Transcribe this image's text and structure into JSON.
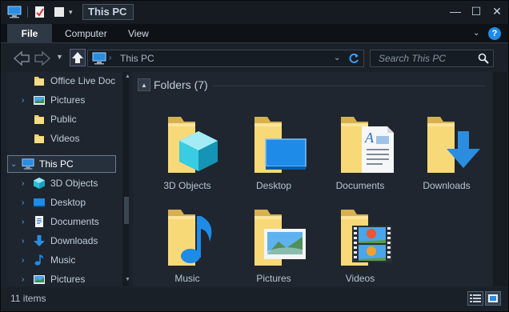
{
  "window": {
    "title": "This PC",
    "minimize_glyph": "—",
    "maximize_glyph": "☐",
    "close_glyph": "✕"
  },
  "ribbon": {
    "tabs": [
      "File",
      "Computer",
      "View"
    ],
    "help_glyph": "?"
  },
  "address": {
    "path": "This PC",
    "search_placeholder": "Search This PC"
  },
  "nav": {
    "items": [
      {
        "label": "Office Live Doc",
        "icon": "folder-icon",
        "indent": 1,
        "expandable": false
      },
      {
        "label": "Pictures",
        "icon": "pictures-icon",
        "indent": 1,
        "expandable": true
      },
      {
        "label": "Public",
        "icon": "folder-icon",
        "indent": 1,
        "expandable": false
      },
      {
        "label": "Videos",
        "icon": "folder-icon",
        "indent": 1,
        "expandable": false
      },
      {
        "label": "This PC",
        "icon": "computer-icon",
        "indent": 0,
        "expandable": true,
        "expanded": true,
        "selected": true
      },
      {
        "label": "3D Objects",
        "icon": "cube-icon",
        "indent": 1,
        "expandable": true
      },
      {
        "label": "Desktop",
        "icon": "desktop-icon",
        "indent": 1,
        "expandable": true
      },
      {
        "label": "Documents",
        "icon": "documents-icon",
        "indent": 1,
        "expandable": true
      },
      {
        "label": "Downloads",
        "icon": "download-icon",
        "indent": 1,
        "expandable": true
      },
      {
        "label": "Music",
        "icon": "music-icon",
        "indent": 1,
        "expandable": true
      },
      {
        "label": "Pictures",
        "icon": "pictures-icon",
        "indent": 1,
        "expandable": true
      }
    ]
  },
  "content": {
    "group_title": "Folders (7)",
    "folders": [
      {
        "label": "3D Objects",
        "overlay": "cube-icon"
      },
      {
        "label": "Desktop",
        "overlay": "desktop-icon"
      },
      {
        "label": "Documents",
        "overlay": "documents-icon"
      },
      {
        "label": "Downloads",
        "overlay": "download-icon"
      },
      {
        "label": "Music",
        "overlay": "music-icon"
      },
      {
        "label": "Pictures",
        "overlay": "pictures-icon"
      },
      {
        "label": "Videos",
        "overlay": "video-icon"
      }
    ]
  },
  "status": {
    "item_count": "11 items"
  },
  "colors": {
    "accent": "#1e8be8",
    "folder": "#f7d774",
    "background": "#1f262f"
  }
}
